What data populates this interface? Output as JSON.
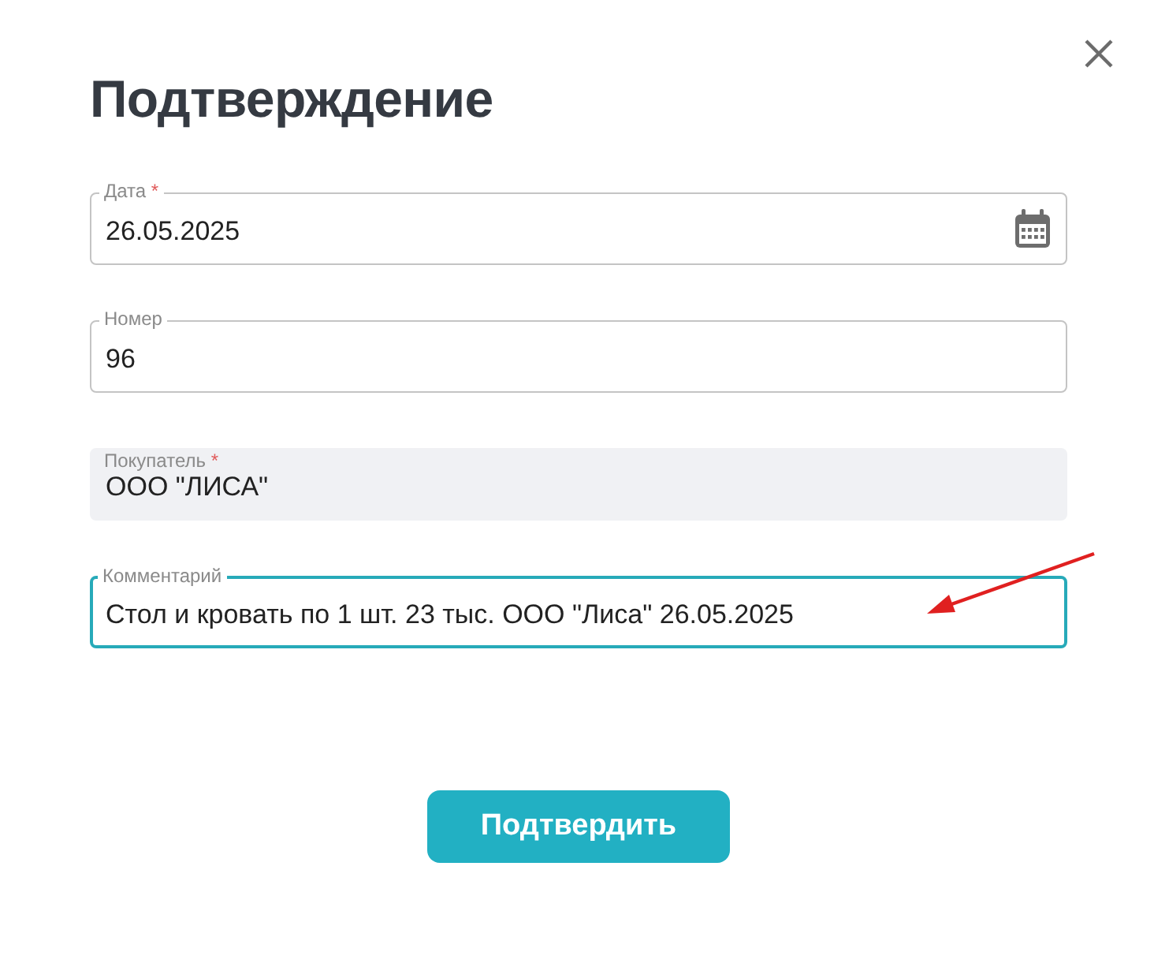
{
  "dialog": {
    "title": "Подтверждение",
    "fields": [
      {
        "kind": "date",
        "label": "Дата",
        "required_mark": "*",
        "value": "26.05.2025",
        "disabled": false,
        "focused": false
      },
      {
        "kind": "text",
        "label": "Номер",
        "value": "96",
        "disabled": false,
        "focused": false
      },
      {
        "kind": "text",
        "label": "Покупатель",
        "required_mark": "*",
        "value": "ООО \"ЛИСА\"",
        "disabled": true,
        "focused": false
      },
      {
        "kind": "text",
        "label": "Комментарий",
        "value": "Стол и кровать по 1 шт. 23 тыс. ООО \"Лиса\" 26.05.2025",
        "disabled": false,
        "focused": true
      }
    ],
    "confirm_button": "Подтвердить"
  }
}
